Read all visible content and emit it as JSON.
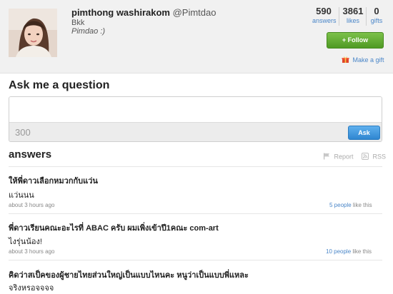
{
  "profile": {
    "name": "pimthong washirakom",
    "handle": "@Pimtdao",
    "location": "Bkk",
    "bio": "Pimdao :)"
  },
  "stats": [
    {
      "value": "590",
      "label": "answers"
    },
    {
      "value": "3861",
      "label": "likes"
    },
    {
      "value": "0",
      "label": "gifts"
    }
  ],
  "actions": {
    "follow_label": "+ Follow",
    "gift_label": "Make a gift"
  },
  "ask": {
    "title": "Ask me a question",
    "placeholder": "",
    "char_count": "300",
    "button_label": "Ask"
  },
  "answers_section": {
    "title": "answers",
    "report_label": "Report",
    "rss_label": "RSS"
  },
  "answers": [
    {
      "question": "ให้พี่ดาวเลือกหมวกกับแว่น",
      "answer": "แว่นนน",
      "time": "about 3 hours ago",
      "likes_count": "5 people",
      "likes_suffix": " like this"
    },
    {
      "question": "พี่ดาวเรียนคณะอะไรที่ ABAC ครับ ผมเพิ่งเข้าปี1คณะ com-art",
      "answer": "ไงรุ่นน้อง!",
      "time": "about 3 hours ago",
      "likes_count": "10 people",
      "likes_suffix": " like this"
    },
    {
      "question": "คิดว่าสเป็คของผู้ชายไทยส่วนใหญ่เป็นแบบไหนคะ หนูว่าเป็นแบบพี่แหละ",
      "answer": "จริงหรอจจจจ"
    }
  ],
  "colors": {
    "header_bg": "#f1f1f1",
    "follow_green": "#5aa52c",
    "ask_blue": "#3a90d8",
    "link_blue": "#4a86c8"
  }
}
